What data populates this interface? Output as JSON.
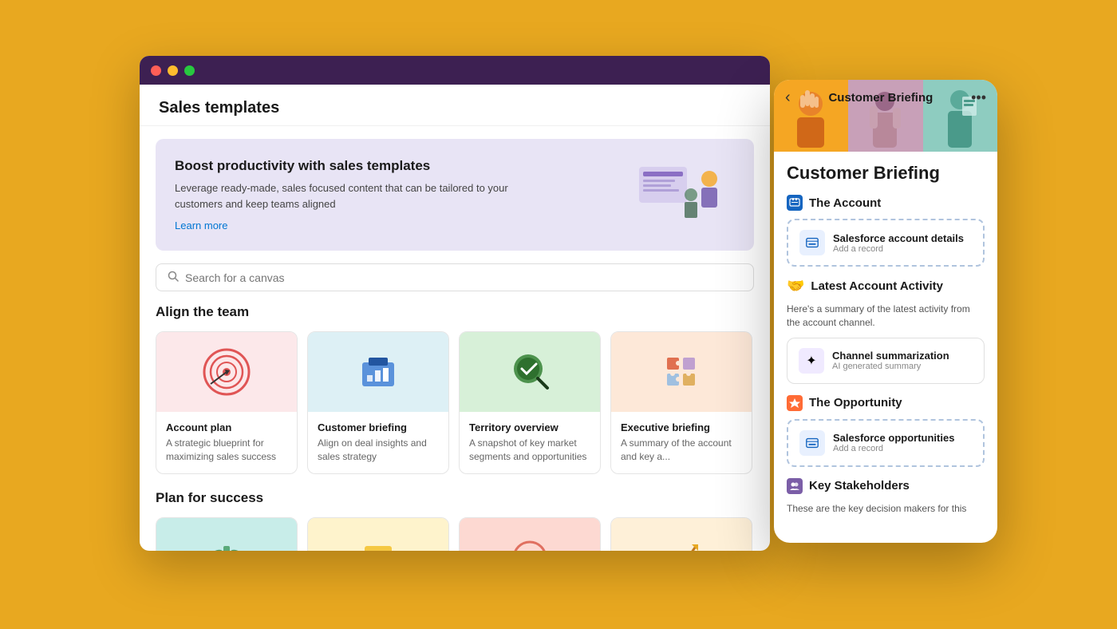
{
  "page": {
    "bg_color": "#E8A820"
  },
  "desktop_window": {
    "title": "Sales templates",
    "hero": {
      "heading": "Boost productivity with sales templates",
      "description": "Leverage ready-made, sales focused content that can be tailored to your customers and keep teams aligned",
      "learn_more": "Learn more"
    },
    "search": {
      "placeholder": "Search for a canvas"
    },
    "sections": [
      {
        "id": "align",
        "heading": "Align the team",
        "cards": [
          {
            "title": "Account plan",
            "desc": "A strategic blueprint for maximizing sales success",
            "color": "pink"
          },
          {
            "title": "Customer briefing",
            "desc": "Align on deal insights and sales strategy",
            "color": "blue"
          },
          {
            "title": "Territory overview",
            "desc": "A snapshot of key market segments and opportunities",
            "color": "green"
          },
          {
            "title": "Executive briefing",
            "desc": "A summary of the account and key a...",
            "color": "peach"
          }
        ]
      },
      {
        "id": "plan",
        "heading": "Plan for success",
        "cards": [
          {
            "title": "",
            "desc": "",
            "color": "teal"
          },
          {
            "title": "",
            "desc": "",
            "color": "yellow"
          },
          {
            "title": "",
            "desc": "",
            "color": "salmon"
          },
          {
            "title": "",
            "desc": "",
            "color": "cream"
          }
        ]
      }
    ]
  },
  "mobile_panel": {
    "back_label": "‹",
    "more_label": "•••",
    "header_title": "Customer Briefing",
    "main_title": "Customer Briefing",
    "sections": [
      {
        "id": "the_account",
        "icon_type": "blue",
        "icon_label": "🏢",
        "title": "The Account",
        "records": [
          {
            "title": "Salesforce account details",
            "sub": "Add a record"
          }
        ]
      },
      {
        "id": "latest_activity",
        "icon_type": "hand",
        "icon_label": "🤝",
        "title": "Latest Account Activity",
        "description": "Here's a summary of the latest activity from the account channel.",
        "channel": {
          "title": "Channel summarization",
          "sub": "AI generated summary"
        }
      },
      {
        "id": "the_opportunity",
        "icon_type": "orange",
        "icon_label": "🎯",
        "title": "The Opportunity",
        "records": [
          {
            "title": "Salesforce opportunities",
            "sub": "Add a record"
          }
        ]
      },
      {
        "id": "key_stakeholders",
        "icon_type": "purple",
        "icon_label": "👥",
        "title": "Key Stakeholders",
        "description": "These are the key decision makers for this"
      }
    ]
  }
}
